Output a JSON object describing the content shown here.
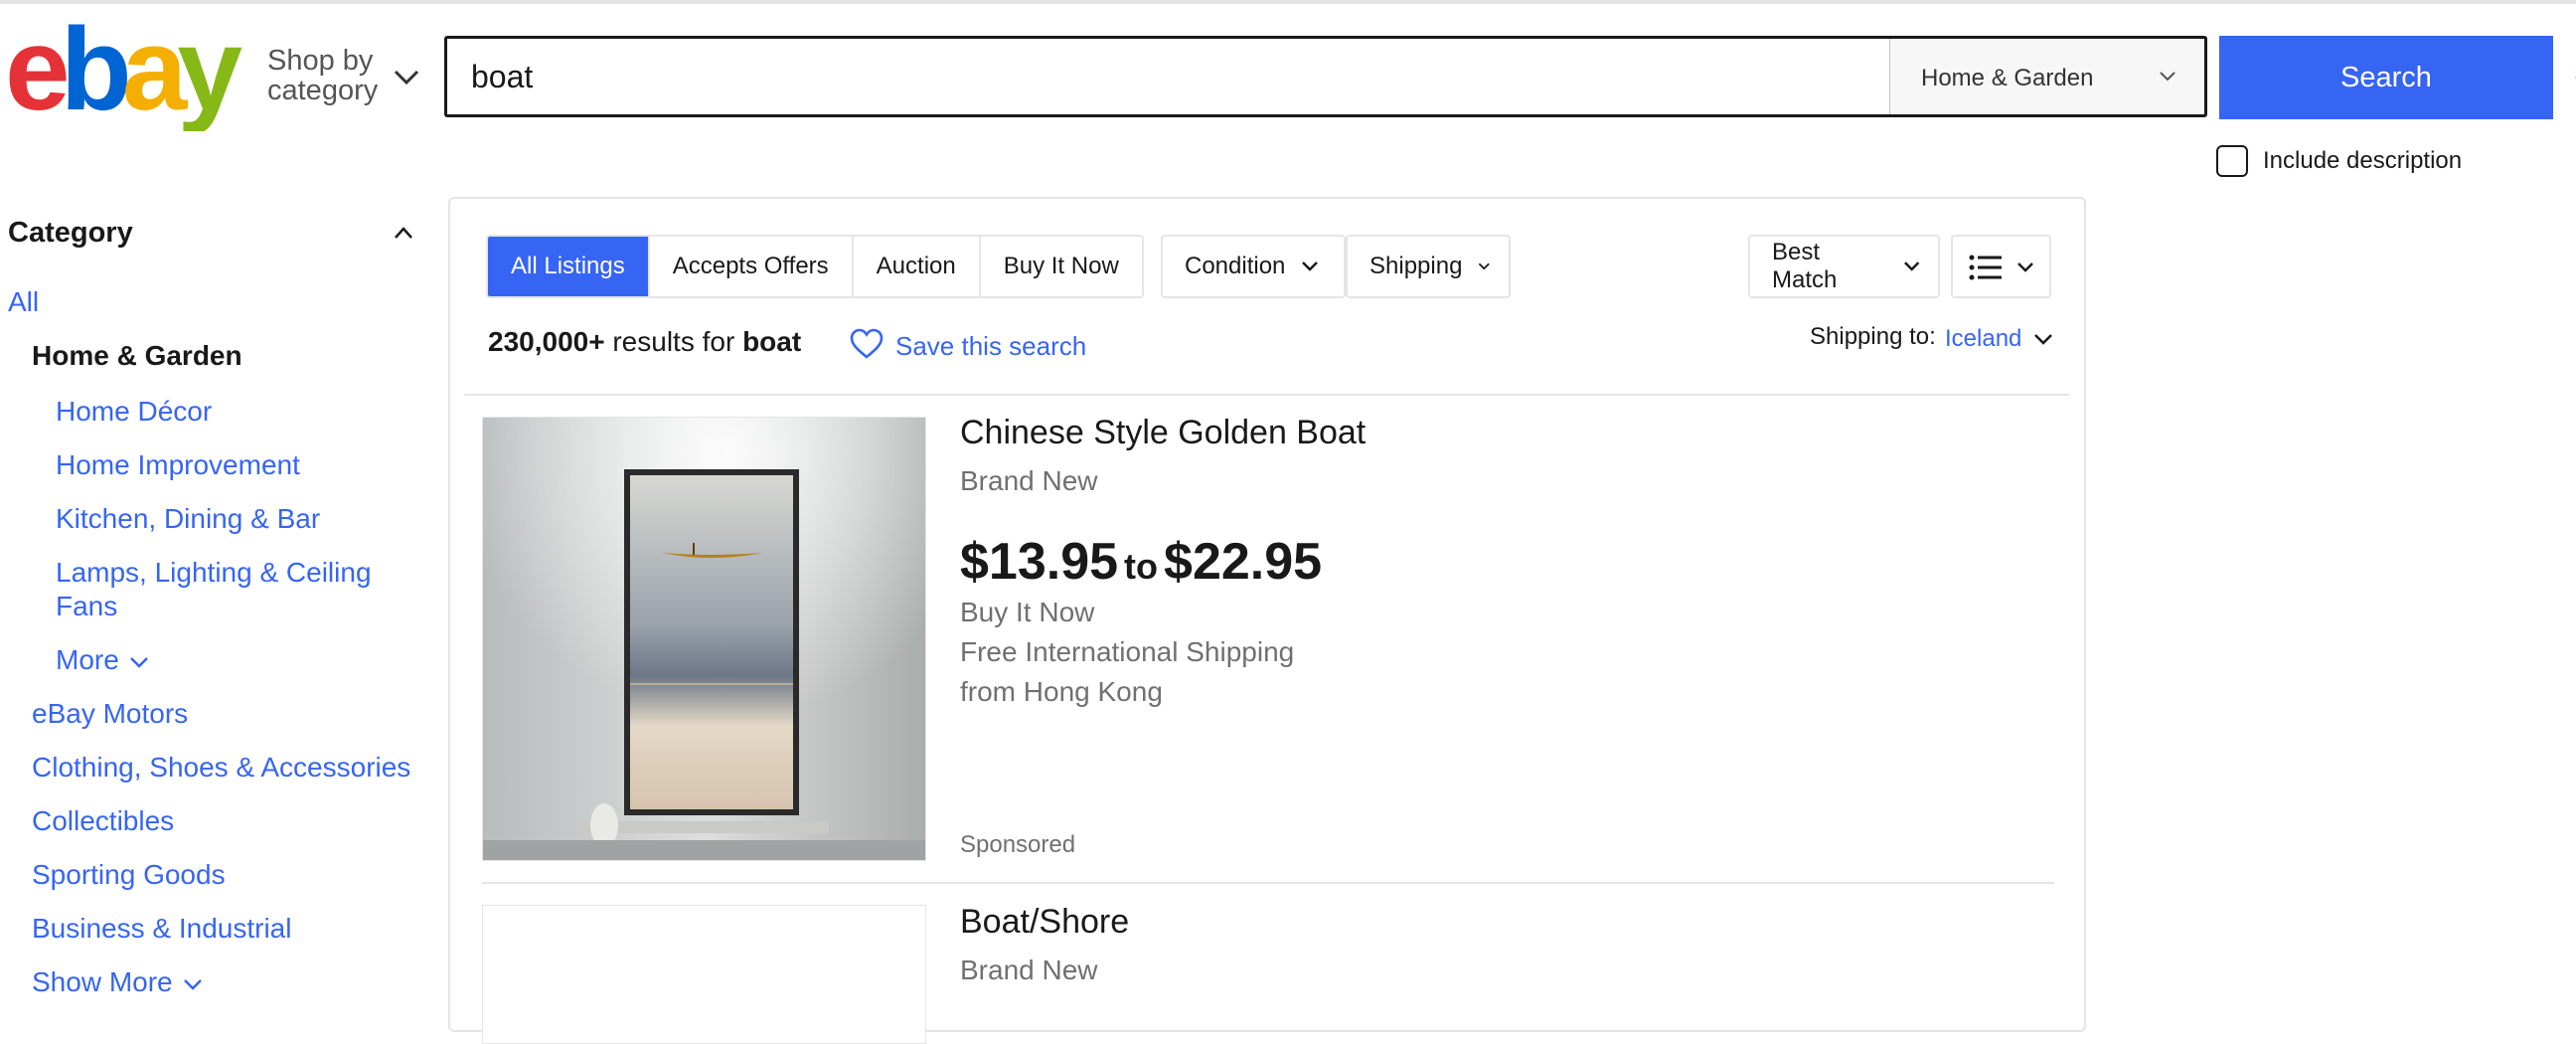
{
  "header": {
    "logo_alt": "ebay",
    "shop_by_line1": "Shop by",
    "shop_by_line2": "category",
    "search_value": "boat",
    "category_select": "Home & Garden",
    "search_button": "Search",
    "include_description": "Include description",
    "include_description_checked": false
  },
  "sidebar": {
    "heading": "Category",
    "all_label": "All",
    "current_category": "Home & Garden",
    "subcategories": [
      "Home Décor",
      "Home Improvement",
      "Kitchen, Dining & Bar",
      "Lamps, Lighting & Ceiling",
      "Fans"
    ],
    "more_label": "More",
    "other_categories": [
      "eBay Motors",
      "Clothing, Shoes & Accessories",
      "Collectibles",
      "Sporting Goods",
      "Business & Industrial"
    ],
    "show_more_label": "Show More"
  },
  "toolbar": {
    "tabs": [
      "All Listings",
      "Accepts Offers",
      "Auction",
      "Buy It Now"
    ],
    "active_tab": "All Listings",
    "condition_label": "Condition",
    "shipping_label": "Shipping",
    "sort_label": "Best Match"
  },
  "results": {
    "count_text": "230,000+",
    "results_for_text": "results for",
    "query": "boat",
    "save_search_label": "Save this search",
    "shipping_to_label": "Shipping to:",
    "shipping_to_value": "Iceland"
  },
  "listings": [
    {
      "title": "Chinese Style Golden Boat",
      "condition": "Brand New",
      "price_low": "$13.95",
      "price_to": "to",
      "price_high": "$22.95",
      "format": "Buy It Now",
      "shipping": "Free International Shipping",
      "location": "from Hong Kong",
      "sponsored": "Sponsored"
    },
    {
      "title": "Boat/Shore",
      "condition": "Brand New"
    }
  ],
  "colors": {
    "brand_blue": "#3665f3",
    "logo_red": "#e53238",
    "logo_blue": "#0064d2",
    "logo_yellow": "#f5af02",
    "logo_green": "#86b817"
  }
}
